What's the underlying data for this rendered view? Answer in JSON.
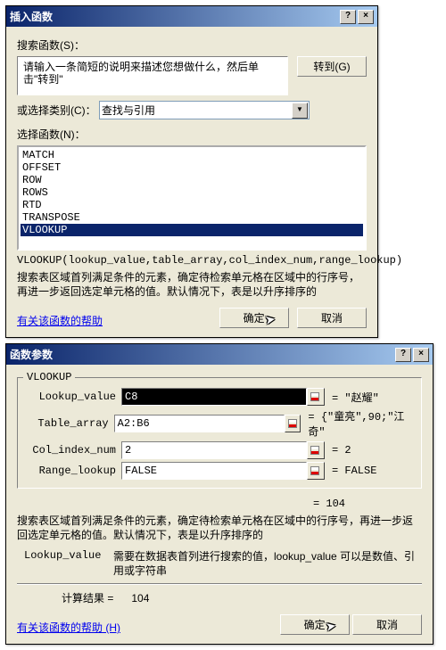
{
  "dialog1": {
    "title": "插入函数",
    "help_btn": "?",
    "close_btn": "×",
    "search_label": "搜索函数(S)：",
    "search_instruction": "请输入一条简短的说明来描述您想做什么，然后单击\"转到\"",
    "go_label": "转到(G)",
    "category_label": "或选择类别(C)：",
    "category_value": "查找与引用",
    "select_label": "选择函数(N)：",
    "list_items": [
      "MATCH",
      "OFFSET",
      "ROW",
      "ROWS",
      "RTD",
      "TRANSPOSE",
      "VLOOKUP"
    ],
    "selected_index": 6,
    "signature": "VLOOKUP(lookup_value,table_array,col_index_num,range_lookup)",
    "description": "搜索表区域首列满足条件的元素，确定待检索单元格在区域中的行序号，再进一步返回选定单元格的值。默认情况下，表是以升序排序的",
    "help_link": "有关该函数的帮助",
    "ok_label": "确定",
    "cancel_label": "取消"
  },
  "dialog2": {
    "title": "函数参数",
    "help_btn": "?",
    "close_btn": "×",
    "group_title": "VLOOKUP",
    "args": [
      {
        "name": "Lookup_value",
        "value": "C8",
        "result": "= \"赵耀\"",
        "dark": true
      },
      {
        "name": "Table_array",
        "value": "A2:B6",
        "result": "= {\"童亮\",90;\"江奇\""
      },
      {
        "name": "Col_index_num",
        "value": "2",
        "result": "= 2"
      },
      {
        "name": "Range_lookup",
        "value": "FALSE",
        "result": "= FALSE"
      }
    ],
    "eq_result": "= 104",
    "description": "搜索表区域首列满足条件的元素，确定待检索单元格在区域中的行序号，再进一步返回选定单元格的值。默认情况下，表是以升序排序的",
    "arg_name": "Lookup_value",
    "arg_explain": "需要在数据表首列进行搜索的值，lookup_value 可以是数值、引用或字符串",
    "calc_label": "计算结果 =",
    "calc_value": "104",
    "help_link": "有关该函数的帮助 (H)",
    "ok_label": "确定",
    "cancel_label": "取消"
  }
}
